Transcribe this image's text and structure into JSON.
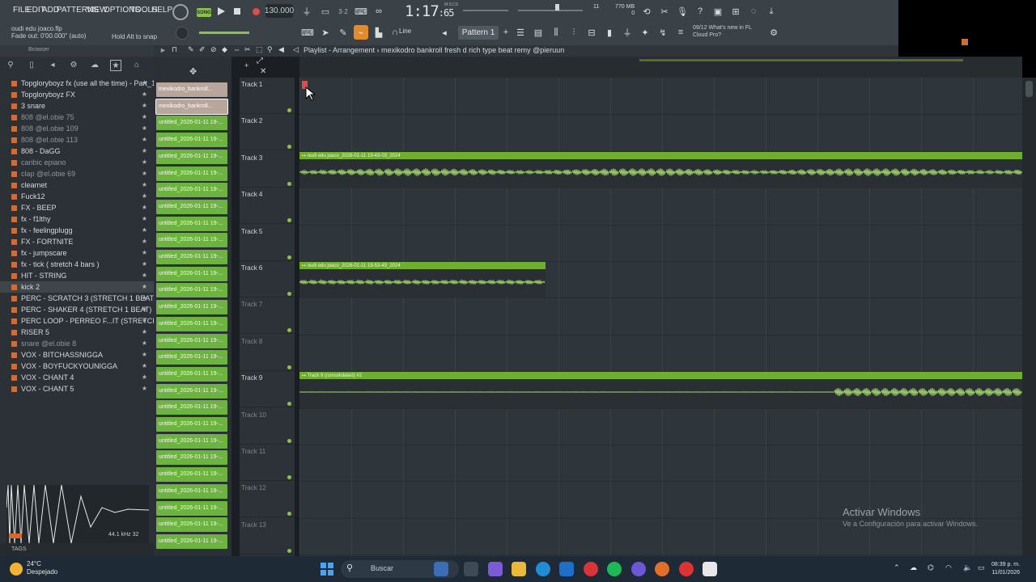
{
  "menu": [
    "FILE",
    "EDIT",
    "ADD",
    "PATTERNS",
    "VIEW",
    "OPTIONS",
    "TOOLS",
    "HELP"
  ],
  "transport": {
    "song_label": "SONG",
    "bpm": "130.000",
    "time": "1:17",
    "time_frac": ":65",
    "time_unit": "M:S:CS",
    "pattern": "Pattern 1",
    "snap": "Line",
    "memory": "770 MB",
    "cpu": "11",
    "voices": "0"
  },
  "file_info": {
    "filename": "oudi edu joaco.flp",
    "fade": "Fade out: 0'00.000\" (auto)",
    "hold_alt": "Hold Alt to snap"
  },
  "news": {
    "line1": "09/12  What's new in FL",
    "line2": "Cloud Pro?"
  },
  "browser": {
    "title": "Browser",
    "items": [
      {
        "label": "Topgloryboyz fx (use all the time) - Part_1",
        "dim": false
      },
      {
        "label": "Topgloryboyz FX",
        "dim": false
      },
      {
        "label": "3 snare",
        "dim": false
      },
      {
        "label": "808 @el.obie 75",
        "dim": true
      },
      {
        "label": "808 @el.obie 109",
        "dim": true
      },
      {
        "label": "808 @el.obie 113",
        "dim": true
      },
      {
        "label": "808 - DaGG",
        "dim": false
      },
      {
        "label": "caribic epiano",
        "dim": true
      },
      {
        "label": "clap @el.obie 69",
        "dim": true
      },
      {
        "label": "clearnet",
        "dim": false
      },
      {
        "label": "Fuck12",
        "dim": false
      },
      {
        "label": "FX - BEEP",
        "dim": false
      },
      {
        "label": "fx - f1lthy",
        "dim": false
      },
      {
        "label": "fx - feelingplugg",
        "dim": false
      },
      {
        "label": "FX - FORTNITE",
        "dim": false
      },
      {
        "label": "fx - jumpscare",
        "dim": false
      },
      {
        "label": "fx - tick ( stretch 4 bars )",
        "dim": false
      },
      {
        "label": "HIT - STRING",
        "dim": false
      },
      {
        "label": "kick 2",
        "dim": false
      },
      {
        "label": "PERC - SCRATCH 3 (STRETCH 1 BEAT)",
        "dim": false
      },
      {
        "label": "PERC - SHAKER 4 (STRETCH 1 BEAT)",
        "dim": false
      },
      {
        "label": "PERC LOOP - PERREO F...IT (STRETCH 4 BARS)",
        "dim": false
      },
      {
        "label": "RISER 5",
        "dim": false
      },
      {
        "label": "snare @el.obie 8",
        "dim": true
      },
      {
        "label": "VOX - BITCHASSNIGGA",
        "dim": false
      },
      {
        "label": "VOX - BOYFUCKYOUNIGGA",
        "dim": false
      },
      {
        "label": "VOX - CHANT 4",
        "dim": false
      },
      {
        "label": "VOX - CHANT 5",
        "dim": false
      }
    ],
    "sample_rate": "44.1 kHz 32",
    "tags_label": "TAGS"
  },
  "playlist": {
    "title": "Playlist - Arrangement › mexikodro  bankroll fresh  d rich type beat remy @pieruun",
    "picker": [
      "mexikodro_bankroll...",
      "mexikodro_bankroll...",
      "untitled_2026-01-11 19-...",
      "untitled_2026-01-11 19-...",
      "untitled_2026-01-11 19-...",
      "untitled_2026-01-11 19-...",
      "untitled_2026-01-11 19-...",
      "untitled_2026-01-11 19-...",
      "untitled_2026-01-11 19-...",
      "untitled_2026-01-11 19-...",
      "untitled_2026-01-11 19-...",
      "untitled_2026-01-11 19-...",
      "untitled_2026-01-11 19-...",
      "untitled_2026-01-11 19-...",
      "untitled_2026-01-11 19-...",
      "untitled_2026-01-11 19-...",
      "untitled_2026-01-11 19-...",
      "untitled_2026-01-11 19-...",
      "untitled_2026-01-11 19-...",
      "untitled_2026-01-11 19-...",
      "untitled_2026-01-11 19-...",
      "untitled_2026-01-11 19-...",
      "untitled_2026-01-11 19-...",
      "untitled_2026-01-11 19-...",
      "untitled_2026-01-11 19-...",
      "untitled_2026-01-11 19-...",
      "untitled_2026-01-11 19-...",
      "untitled_2026-01-11 19-..."
    ],
    "tracks": [
      {
        "name": "Track 1",
        "dim": false
      },
      {
        "name": "Track 2",
        "dim": false
      },
      {
        "name": "Track 3",
        "dim": false
      },
      {
        "name": "Track 4",
        "dim": false
      },
      {
        "name": "Track 5",
        "dim": false
      },
      {
        "name": "Track 6",
        "dim": false
      },
      {
        "name": "Track 7",
        "dim": true
      },
      {
        "name": "Track 8",
        "dim": true
      },
      {
        "name": "Track 9",
        "dim": false
      },
      {
        "name": "Track 10",
        "dim": true
      },
      {
        "name": "Track 11",
        "dim": true
      },
      {
        "name": "Track 12",
        "dim": true
      },
      {
        "name": "Track 13",
        "dim": true
      }
    ],
    "clips": [
      {
        "track": 3,
        "label": "↦ oudi edu joaco_2026-01-11 19-43-03_2024"
      },
      {
        "track": 6,
        "label": "↦ oudi edu joaco_2026-01-11 19-53-49_2024"
      },
      {
        "track": 9,
        "label": "↦ Track 9 (consolidated) #2"
      }
    ]
  },
  "windows_watermark": {
    "title": "Activar Windows",
    "subtitle": "Ve a Configuración para activar Windows."
  },
  "taskbar": {
    "temp": "24°C",
    "weather": "Despejado",
    "search_placeholder": "Buscar",
    "time": "08:39 p. m.",
    "date": "11/01/2026"
  },
  "colors": {
    "accent_green": "#6fae2f",
    "toolbar": "#3a4147",
    "panel": "#2b3136"
  }
}
